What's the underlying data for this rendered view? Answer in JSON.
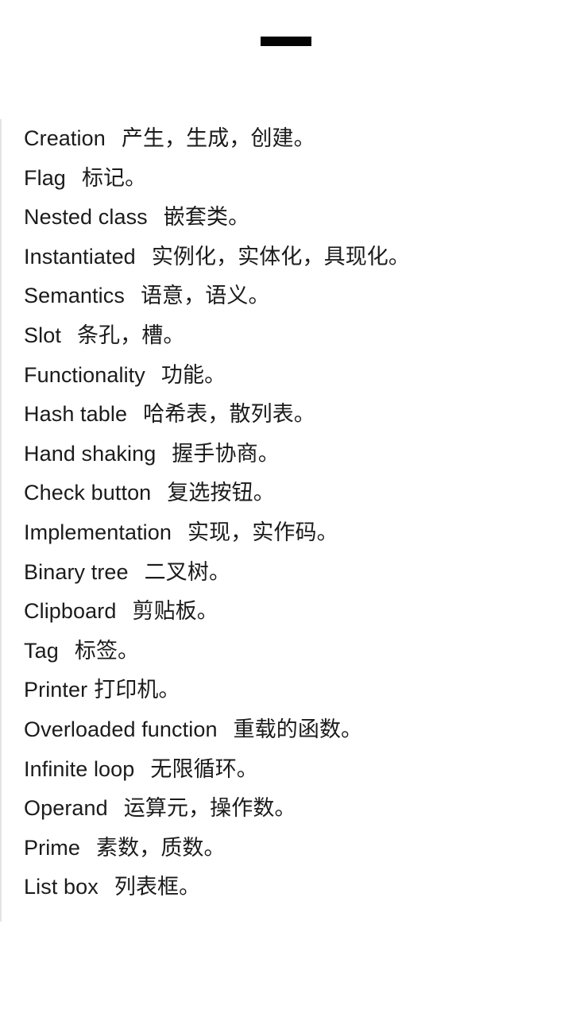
{
  "topbar": {
    "handle_label": "drag-handle",
    "handle_color": "#050505"
  },
  "panel": {
    "divider_color": "#e3e3e3",
    "background_color": "#ffffff",
    "text_color": "#1b1b1b"
  },
  "glossary": {
    "entries": [
      {
        "term": "Creation",
        "spacing": "wide",
        "definition": "产生，生成，创建。"
      },
      {
        "term": "Flag",
        "spacing": "wide",
        "definition": "标记。"
      },
      {
        "term": "Nested class",
        "spacing": "wide",
        "definition": "嵌套类。"
      },
      {
        "term": "Instantiated",
        "spacing": "wide",
        "definition": "实例化，实体化，具现化。"
      },
      {
        "term": "Semantics",
        "spacing": "wide",
        "definition": "语意，语义。"
      },
      {
        "term": "Slot",
        "spacing": "wide",
        "definition": "条孔，槽。"
      },
      {
        "term": "Functionality",
        "spacing": "wide",
        "definition": "功能。"
      },
      {
        "term": "Hash table",
        "spacing": "wide",
        "definition": "哈希表，散列表。"
      },
      {
        "term": "Hand shaking",
        "spacing": "wide",
        "definition": "握手协商。"
      },
      {
        "term": "Check button",
        "spacing": "wide",
        "definition": "复选按钮。"
      },
      {
        "term": "Implementation",
        "spacing": "wide",
        "definition": "实现，实作码。"
      },
      {
        "term": "Binary tree",
        "spacing": "wide",
        "definition": "二叉树。"
      },
      {
        "term": "Clipboard",
        "spacing": "wide",
        "definition": "剪贴板。"
      },
      {
        "term": "Tag",
        "spacing": "wide",
        "definition": "标签。"
      },
      {
        "term": "Printer",
        "spacing": "narrow",
        "definition": "打印机。"
      },
      {
        "term": "Overloaded function",
        "spacing": "wide",
        "definition": "重载的函数。"
      },
      {
        "term": "Infinite loop",
        "spacing": "wide",
        "definition": "无限循环。"
      },
      {
        "term": "Operand",
        "spacing": "wide",
        "definition": "运算元，操作数。"
      },
      {
        "term": "Prime",
        "spacing": "wide",
        "definition": "素数，质数。"
      },
      {
        "term": "List box",
        "spacing": "wide",
        "definition": "列表框。"
      }
    ]
  }
}
